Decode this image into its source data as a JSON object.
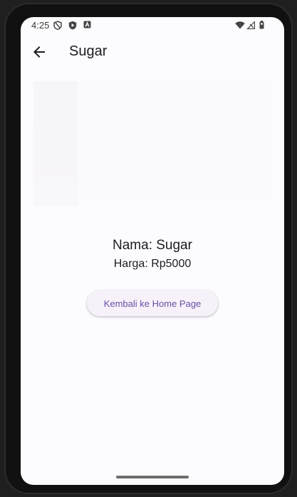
{
  "status_bar": {
    "time": "4:25",
    "icons": [
      "shield-icon",
      "play-protect-icon",
      "a-icon",
      "wifi-icon",
      "signal-icon",
      "battery-icon"
    ]
  },
  "app_bar": {
    "back_icon": "arrow-left-icon",
    "title": "Sugar"
  },
  "product": {
    "name_line": "Nama: Sugar",
    "price_line": "Harga: Rp5000"
  },
  "actions": {
    "back_home_label": "Kembali ke Home Page"
  },
  "colors": {
    "background": "#fcfbfe",
    "button_background": "#f7f2fa",
    "button_text": "#6750a4",
    "text": "#1c1b1f"
  }
}
